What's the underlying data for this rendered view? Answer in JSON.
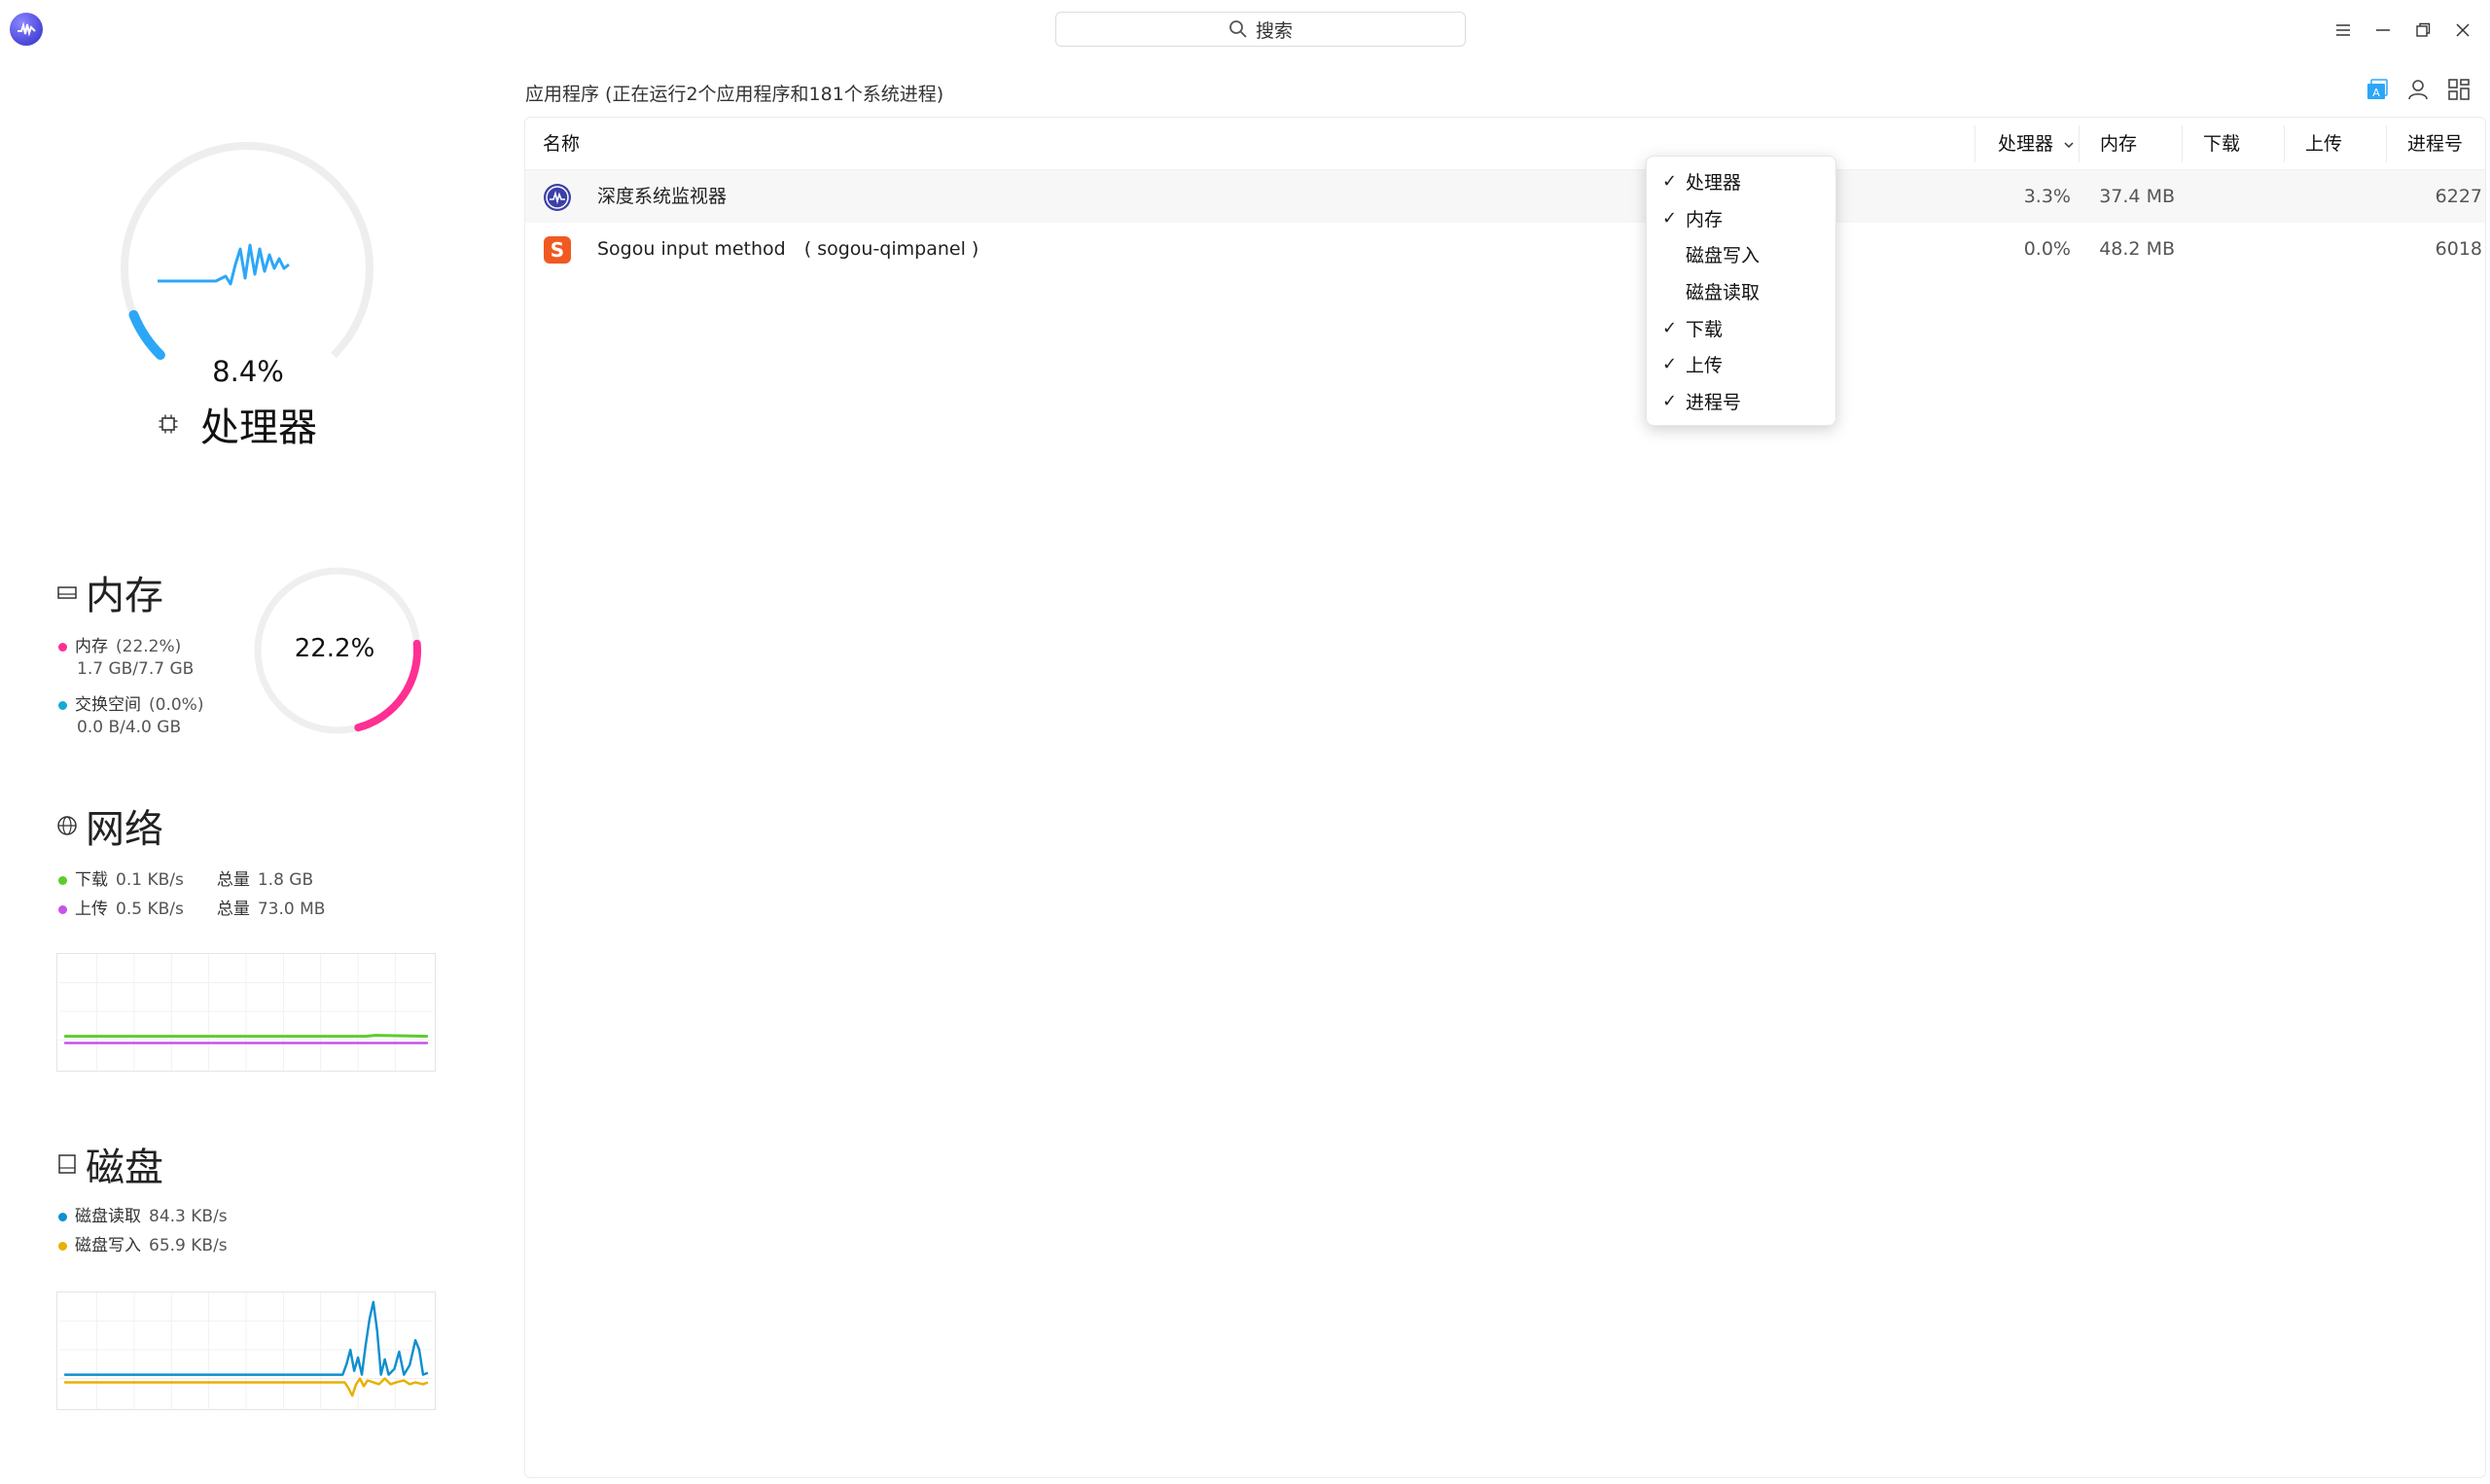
{
  "titlebar": {
    "search_label": "搜索",
    "icons": [
      "app-logo",
      "search-icon",
      "menu-icon",
      "minimize-icon",
      "restore-icon",
      "close-icon"
    ]
  },
  "cpu": {
    "value": "8.4%",
    "percent": 8.4,
    "title": "处理器",
    "color": "#2ca7f8"
  },
  "memory": {
    "title": "内存",
    "value": "22.2%",
    "percent": 22.2,
    "mem_label": "内存",
    "mem_pct": "(22.2%)",
    "mem_used": "1.7 GB/7.7 GB",
    "swap_label": "交换空间",
    "swap_pct": "(0.0%)",
    "swap_used": "0.0 B/4.0 GB",
    "mem_color": "#ff2f93",
    "swap_color": "#14aad1"
  },
  "network": {
    "title": "网络",
    "down_label": "下载",
    "down_rate": "0.1 KB/s",
    "down_total_label": "总量",
    "down_total": "1.8 GB",
    "up_label": "上传",
    "up_rate": "0.5 KB/s",
    "up_total_label": "总量",
    "up_total": "73.0 MB",
    "down_color": "#5ccc2e",
    "up_color": "#c653e8"
  },
  "disk": {
    "title": "磁盘",
    "read_label": "磁盘读取",
    "read_rate": "84.3 KB/s",
    "write_label": "磁盘写入",
    "write_rate": "65.9 KB/s",
    "read_color": "#0f8fd0",
    "write_color": "#e8b000"
  },
  "main": {
    "header": "应用程序 (正在运行2个应用程序和181个系统进程)",
    "columns": {
      "name": "名称",
      "cpu": "处理器",
      "memory": "内存",
      "download": "下载",
      "upload": "上传",
      "pid": "进程号"
    },
    "rows": [
      {
        "name": "深度系统监视器",
        "cpu": "3.3%",
        "memory": "37.4 MB",
        "download": "",
        "upload": "",
        "pid": "6227",
        "icon": "deepin-monitor-icon"
      },
      {
        "name": "Sogou input method　( sogou-qimpanel )",
        "cpu": "0.0%",
        "memory": "48.2 MB",
        "download": "",
        "upload": "",
        "pid": "6018",
        "icon": "sogou-icon"
      }
    ]
  },
  "column_menu": {
    "items": [
      {
        "label": "处理器",
        "check": "✓"
      },
      {
        "label": "内存",
        "check": "✓"
      },
      {
        "label": "磁盘写入",
        "check": ""
      },
      {
        "label": "磁盘读取",
        "check": ""
      },
      {
        "label": "下载",
        "check": "✓"
      },
      {
        "label": "上传",
        "check": "✓"
      },
      {
        "label": "进程号",
        "check": "✓"
      }
    ]
  }
}
